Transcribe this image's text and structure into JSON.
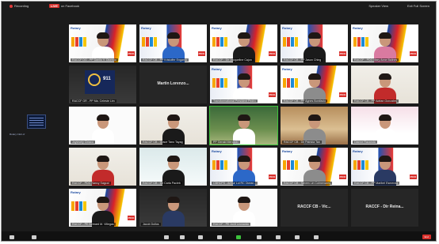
{
  "topbar": {
    "recording_label": "Recording",
    "live_badge": "LIVE",
    "live_label": "on Facebook",
    "speaker_view": "Speaker View",
    "gallery_view": "Exit Full Screen"
  },
  "brand": {
    "rotary": "Rotary",
    "pico": "PICO"
  },
  "tiles": [
    {
      "name": "RACCF DG - PP Danilo V. Dionisio",
      "variant": "b2",
      "torso": "white"
    },
    {
      "name": "RACCF CB - PP Kristoffer Engardo",
      "variant": "b3",
      "torso": "blue"
    },
    {
      "name": "RACCF - Dir Jacqueline Cajon",
      "variant": "b2",
      "torso": "black"
    },
    {
      "name": "RACCF CB - PP Jason Ching",
      "variant": "b3",
      "torso": "black"
    },
    {
      "name": "RACCF - PDG Mary Anne Balines",
      "variant": "b2",
      "torso": "pink"
    },
    {
      "name": "RACCF GR - PP Ma. Celeste Lim",
      "variant": "seal"
    },
    {
      "name": "Martin Lorenzo...",
      "variant": "textonly"
    },
    {
      "name": "Transformational President Pedro",
      "variant": "b3",
      "torso": "white"
    },
    {
      "name": "RACCF CB - PP Agnes Bonifacio",
      "variant": "b2",
      "torso": "grey"
    },
    {
      "name": "RACCF CB - PP Adrian Gonzales",
      "variant": "wall",
      "torso": "red"
    },
    {
      "name": "Joylovely Ciriaco",
      "variant": "white",
      "torso": "white"
    },
    {
      "name": "RACCF CB - Grace Tano Tayag",
      "variant": "wall",
      "torso": "black"
    },
    {
      "name": "PP Gerald Mercado",
      "variant": "green",
      "torso": "white",
      "active": true
    },
    {
      "name": "RACCF CB - Dir Patricia Tan",
      "variant": "wood",
      "torso": "grey"
    },
    {
      "name": "Dianne Racanda",
      "variant": "pink",
      "torso": "white"
    },
    {
      "name": "RACCF - PDG Nancy Sagcal",
      "variant": "wall",
      "torso": "red"
    },
    {
      "name": "RACCF CB - Dir Carla Pacleb",
      "variant": "teal",
      "torso": "black"
    },
    {
      "name": "CBHCPS - Arthur Lui RC Ocean...",
      "variant": "b3",
      "torso": "blue"
    },
    {
      "name": "RACCF CB - Steven Lin Colmenares",
      "variant": "b2",
      "torso": "grey"
    },
    {
      "name": "RACCF CB - PP Maribel Esmenda",
      "variant": "b3",
      "torso": "dark"
    },
    {
      "name": "RACCF - PE Bernard M. Villegas",
      "variant": "b2",
      "torso": "black"
    },
    {
      "name": "Jacob Dollos",
      "variant": "dark",
      "torso": "dark"
    },
    {
      "name": "RACCF - PE Jovit Leonardo",
      "variant": "white",
      "torso": "white"
    },
    {
      "name": "RACCF CB - Vic...",
      "variant": "textonly"
    },
    {
      "name": "RACCF - Dir Reina...",
      "variant": "textonly"
    }
  ],
  "seal_text": "911",
  "sidebar_thumb_label": "Rotary Club of",
  "toolbar": {
    "items": [
      "Unmute",
      "Start Video",
      "Security",
      "Participants",
      "Chat",
      "Share Screen",
      "Record",
      "Reactions"
    ],
    "end": "End"
  }
}
